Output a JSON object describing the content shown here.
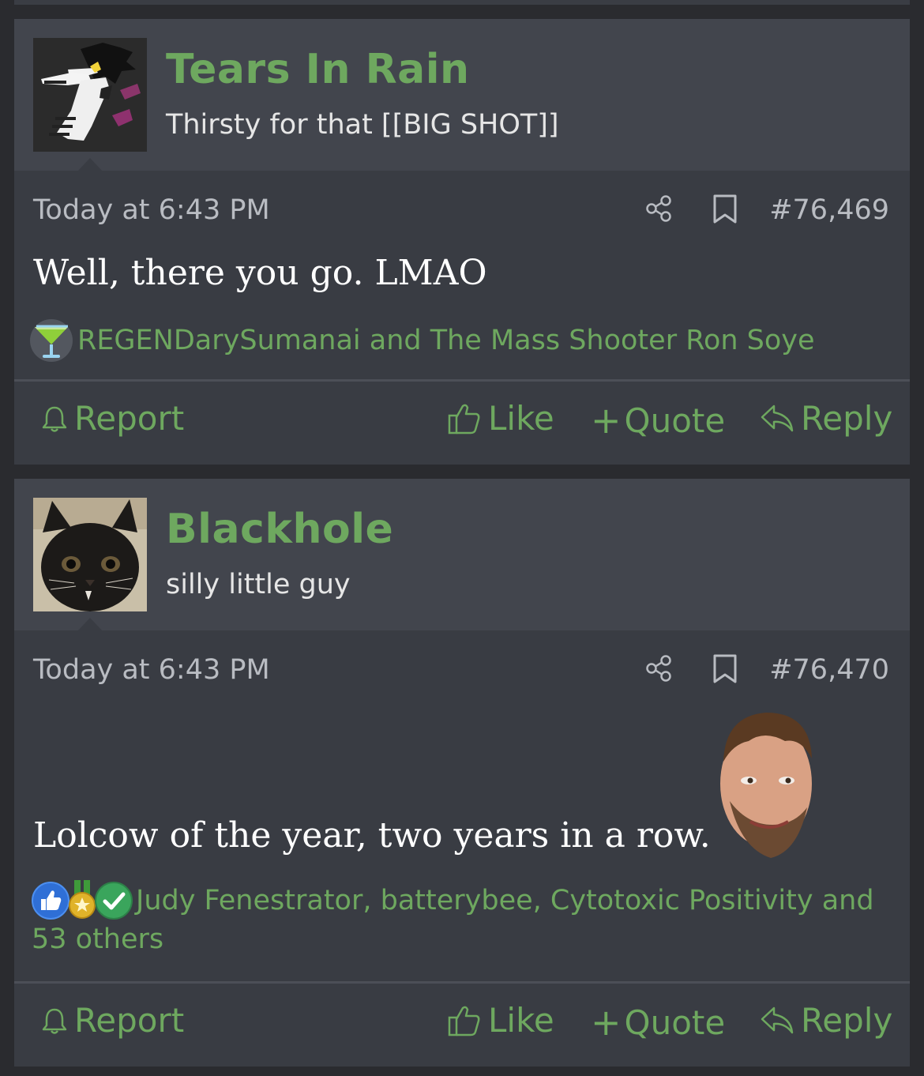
{
  "posts": [
    {
      "username": "Tears In Rain",
      "user_title": "Thirsty for that [[BIG SHOT]]",
      "date": "Today at 6:43 PM",
      "post_number": "#76,469",
      "body": "Well, there you go. LMAO",
      "reactions_text": "REGENDarySumanai and The Mass Shooter Ron Soye",
      "reaction_icons": [
        "cocktail-icon"
      ]
    },
    {
      "username": "Blackhole",
      "user_title": "silly little guy",
      "date": "Today at 6:43 PM",
      "post_number": "#76,470",
      "body": "Lolcow of the year, two years in a row.",
      "reactions_text_line1": "Judy Fenestrator, batterybee, Cytotoxic Positivity and",
      "reactions_text_line2": "53 others",
      "reaction_icons": [
        "thumbs-up-icon",
        "medal-icon",
        "check-icon"
      ]
    }
  ],
  "actions": {
    "report": "Report",
    "like": "Like",
    "quote": "Quote",
    "reply": "Reply"
  },
  "colors": {
    "accent": "#6ea85f",
    "background": "#2a2b2f",
    "post_bg": "#393c43",
    "header_bg": "#42454d"
  }
}
